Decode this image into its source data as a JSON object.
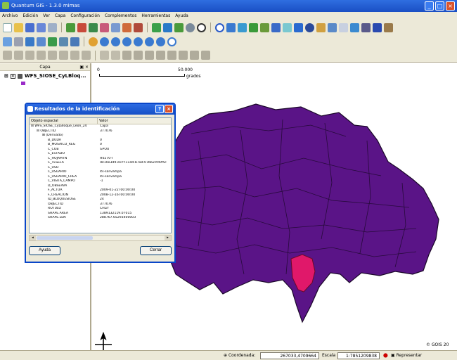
{
  "window": {
    "title": "Quantum GIS - 1.3.0 mimas"
  },
  "menu": [
    "Archivo",
    "Edición",
    "Ver",
    "Capa",
    "Configuración",
    "Complementos",
    "Herramientas",
    "Ayuda"
  ],
  "legend": {
    "header": "Capa",
    "layer_name": "WFS_SIOSE_CyLBloq..."
  },
  "scalebar": {
    "start": "0",
    "end": "50.000",
    "unit": "grados"
  },
  "dialog": {
    "title": "Resultados de la identificación",
    "col_feature": "Objeto espacial",
    "col_value": "Valor",
    "rows": [
      {
        "k": "WFS_SIOSE_CyLBloque_Leon_24",
        "v": "Capa",
        "indent": 0,
        "icon": "⊟"
      },
      {
        "k": "OBJECTID",
        "v": "377076",
        "indent": 1,
        "icon": "⊟"
      },
      {
        "k": "(Derivado)",
        "v": "",
        "indent": 2,
        "icon": "⊞"
      },
      {
        "k": "B_DUDA",
        "v": "0",
        "indent": 3,
        "icon": ""
      },
      {
        "k": "B_MOSAICO_REG",
        "v": "0",
        "indent": 3,
        "icon": ""
      },
      {
        "k": "C_COB",
        "v": "GPOU",
        "indent": 3,
        "icon": ""
      },
      {
        "k": "C_ESTADO",
        "v": "",
        "indent": 3,
        "icon": ""
      },
      {
        "k": "C_HOJAMTN",
        "v": "H0270-I",
        "indent": 3,
        "icon": ""
      },
      {
        "k": "C_TESELA",
        "v": "d410e3d9-e07f-11dd-b7ad-07bb2cfd0f5c",
        "indent": 3,
        "icon": ""
      },
      {
        "k": "C_USO",
        "v": "",
        "indent": 3,
        "icon": ""
      },
      {
        "k": "C_USUARIO",
        "v": "its-sanvampa",
        "indent": 3,
        "icon": ""
      },
      {
        "k": "C_USUARIO_CREA",
        "v": "its-sanvampa",
        "indent": 3,
        "icon": ""
      },
      {
        "k": "C_VISITA_CAMPO",
        "v": "-1",
        "indent": 3,
        "icon": ""
      },
      {
        "k": "D_OBSERVA",
        "v": "",
        "indent": 3,
        "icon": ""
      },
      {
        "k": "F_ACTUA",
        "v": "2009-01-22T00:00:00",
        "indent": 3,
        "icon": ""
      },
      {
        "k": "F_CREACION",
        "v": "2008-12-16T00:00:00",
        "indent": 3,
        "icon": ""
      },
      {
        "k": "ID_BLOQUESIOSE",
        "v": "24",
        "indent": 3,
        "icon": ""
      },
      {
        "k": "OBJECTID",
        "v": "377076",
        "indent": 3,
        "icon": ""
      },
      {
        "k": "ROTULO",
        "v": "CHLrr",
        "indent": 3,
        "icon": ""
      },
      {
        "k": "SHAPE.AREA",
        "v": "1389132119.07015",
        "indent": 3,
        "icon": ""
      },
      {
        "k": "SHAPE.LEN",
        "v": "288767.65293400003",
        "indent": 3,
        "icon": ""
      }
    ],
    "help_label": "Ayuda",
    "close_label": "Cerrar"
  },
  "status": {
    "coord_label": "Coordenada:",
    "coord_value": "267033,4709664",
    "scale_label": "Escala",
    "scale_value": "1:7851209838",
    "render_label": "Representar",
    "copyright": "© GOIS 20"
  },
  "colors": {
    "region_fill": "#5a1487",
    "selected_fill": "#e0186a",
    "titlebar": "#1a4fc4",
    "chrome": "#ece9d8"
  }
}
